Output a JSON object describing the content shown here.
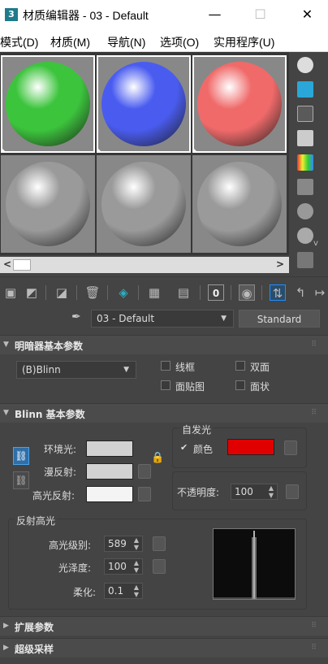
{
  "window": {
    "icon_text": "3",
    "title": "材质编辑器 - 03 - Default",
    "minimize": "—",
    "maximize": "☐",
    "close": "✕"
  },
  "menu": [
    "模式(D)",
    "材质(M)",
    "导航(N)",
    "选项(O)",
    "实用程序(U)"
  ],
  "slots": [
    {
      "color": "#3cc43c",
      "selected": true
    },
    {
      "color": "#4a5cf0",
      "selected": true
    },
    {
      "color": "#f06a6a",
      "selected": true
    },
    {
      "color": "#9a9a9a",
      "selected": false
    },
    {
      "color": "#9a9a9a",
      "selected": false
    },
    {
      "color": "#9a9a9a",
      "selected": false
    }
  ],
  "scroll": {
    "left": "<",
    "right": ">",
    "down": "v"
  },
  "material": {
    "name": "03 - Default",
    "type_button": "Standard"
  },
  "shader_rollout": {
    "title": "明暗器基本参数",
    "shader": "(B)Blinn",
    "options": [
      {
        "label": "线框",
        "checked": false
      },
      {
        "label": "双面",
        "checked": false
      },
      {
        "label": "面贴图",
        "checked": false
      },
      {
        "label": "面状",
        "checked": false
      }
    ]
  },
  "blinn_rollout": {
    "title": "Blinn 基本参数",
    "ambient_label": "环境光:",
    "diffuse_label": "漫反射:",
    "specular_label": "高光反射:",
    "ambient_color": "#d2d2d2",
    "diffuse_color": "#d2d2d2",
    "specular_color": "#f4f4f4",
    "self_illum": {
      "group_label": "自发光",
      "color_label": "颜色",
      "checked": true,
      "color": "#e00000",
      "check_mark": "✔"
    },
    "opacity": {
      "label": "不透明度:",
      "value": "100"
    },
    "specular_group": {
      "label": "反射高光",
      "level_label": "高光级别:",
      "level_value": "589",
      "gloss_label": "光泽度:",
      "gloss_value": "100",
      "soften_label": "柔化:",
      "soften_value": "0.1"
    }
  },
  "extended_rollout": {
    "title": "扩展参数"
  },
  "supersampling_rollout": {
    "title": "超级采样"
  },
  "colors": {
    "panel": "#444444",
    "accent": "#1e90ff"
  }
}
